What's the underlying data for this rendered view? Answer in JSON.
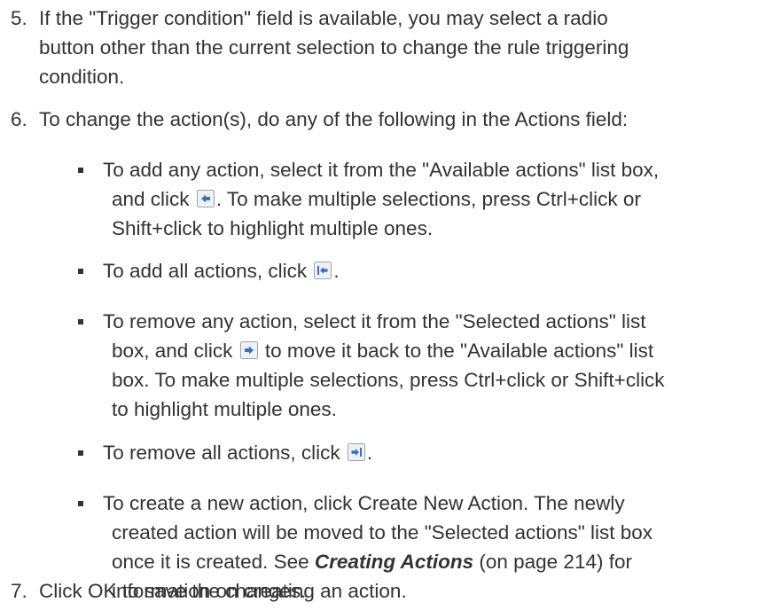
{
  "steps": {
    "s5": {
      "number": "5.",
      "line1": "If the \"Trigger condition\" field is available, you may select a radio",
      "line2": "button other than the current selection to change the rule triggering",
      "line3": "condition."
    },
    "s6": {
      "number": "6.",
      "line1": "To change the action(s), do any of the following in the Actions field:"
    },
    "s7": {
      "number": "7.",
      "line1": "Click OK to save the changes."
    }
  },
  "bullets": {
    "add_action": {
      "line1": "To add any action, select it from the \"Available actions\" list box,",
      "line2_pre": "and click",
      "line2_post": ". To make multiple selections, press Ctrl+click or",
      "line3": "Shift+click to highlight multiple ones."
    },
    "add_all": {
      "pre": "To add all actions, click",
      "post": "."
    },
    "remove_action": {
      "line1": "To remove any action, select it from the \"Selected actions\" list",
      "line2_pre": "box, and click",
      "line2_post": "to move it back to the \"Available actions\" list",
      "line3": "box. To make multiple selections, press Ctrl+click or Shift+click",
      "line4": "to highlight multiple ones."
    },
    "remove_all": {
      "pre": "To remove all actions, click",
      "post": "."
    },
    "create_action": {
      "line1": "To create a new action, click Create New Action. The newly",
      "line2": "created action will be moved to the \"Selected actions\" list box",
      "line3_pre": "once it is created. See",
      "xref": "Creating Actions",
      "line3_post": "(on page 214) for",
      "line4": "information on creating an action."
    }
  },
  "icons": {
    "add_one": "arrow-left-icon",
    "add_all": "arrow-left-bar-icon",
    "remove_one": "arrow-right-icon",
    "remove_all": "arrow-right-bar-icon"
  },
  "colors": {
    "text": "#333333",
    "icon_border": "#9aa4b0",
    "icon_fill": "#eef2f7",
    "icon_arrow": "#3a6fc4"
  }
}
